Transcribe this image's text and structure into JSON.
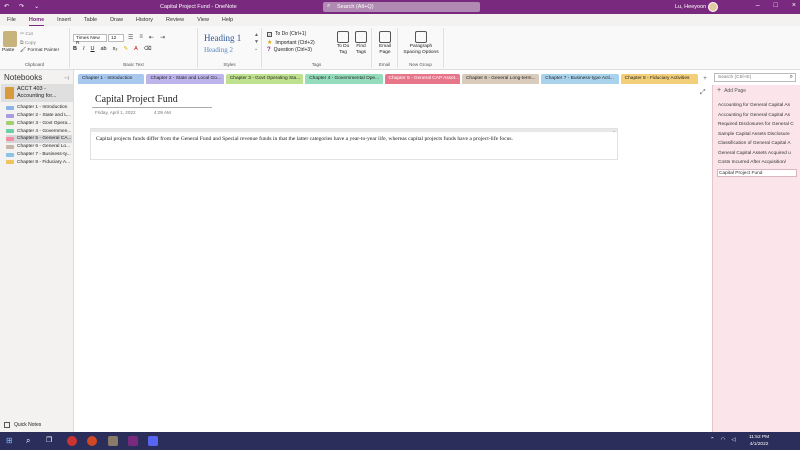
{
  "app": {
    "doc_title": "Capital Project Fund - OneNote",
    "search_placeholder": "Search (Alt+Q)",
    "user_name": "Lu, Heeyoon",
    "quick_access": [
      "↶",
      "↷",
      "⌄"
    ]
  },
  "ribbon_tabs": [
    "File",
    "Home",
    "Insert",
    "Table",
    "Draw",
    "History",
    "Review",
    "View",
    "Help"
  ],
  "clipboard": {
    "paste": "Paste",
    "cut": "Cut",
    "copy": "Copy",
    "format_painter": "Format Painter",
    "group": "Clipboard"
  },
  "basic_text": {
    "font": "Times New R",
    "size": "12",
    "bold": "B",
    "italic": "I",
    "underline": "U",
    "group": "Basic Text"
  },
  "styles": {
    "heading1": "Heading 1",
    "heading2": "Heading 2",
    "group": "Styles"
  },
  "tags": {
    "todo": "To Do (Ctrl+1)",
    "important": "Important (Ctrl+2)",
    "question": "Question (Ctrl+3)",
    "group": "Tags",
    "todo_tag": "To Do Tag",
    "find_tags": "Find Tags"
  },
  "email": {
    "label": "Email Page",
    "group": "Email"
  },
  "new_group": {
    "label": "Paragraph Spacing Options",
    "group": "New Group"
  },
  "notebook": {
    "header": "Notebooks",
    "title": "ACCT 403 - Accounting for...",
    "sections": [
      {
        "label": "Chapter 1 - Introduction",
        "color": "#8ab4e8"
      },
      {
        "label": "Chapter 2 - State and L...",
        "color": "#a79ce0"
      },
      {
        "label": "Chapter 3 - Govt Opera...",
        "color": "#a5cf6e"
      },
      {
        "label": "Chapter 4 - Governmen...",
        "color": "#6ccfa4"
      },
      {
        "label": "Chapter 5 - General CA...",
        "color": "#ef8f9f"
      },
      {
        "label": "Chapter 6 - General Lo...",
        "color": "#c7b6a3"
      },
      {
        "label": "Chapter 7 - Business-ty...",
        "color": "#88c4e6"
      },
      {
        "label": "Chapter 8 - Fiduciary A...",
        "color": "#efc45c"
      }
    ],
    "quick_notes": "Quick Notes"
  },
  "section_tabs": [
    {
      "label": "Chapter 1 - Introduction",
      "color": "#a9c8ef"
    },
    {
      "label": "Chapter 2 - State and Local Go...",
      "color": "#beb4ec"
    },
    {
      "label": "Chapter 3 - Govt Operating Sta...",
      "color": "#bfe08f"
    },
    {
      "label": "Chapter 4 - Governmental Ope...",
      "color": "#94dcbc"
    },
    {
      "label": "Chapter 5 - General CAP Asset...",
      "color": "#e8768a"
    },
    {
      "label": "Chapter 6 - General Long-term...",
      "color": "#d9ccbd"
    },
    {
      "label": "Chapter 7 - Business-type Acti...",
      "color": "#a9d3ec"
    },
    {
      "label": "Chapter 8 - Fiduciary Activities",
      "color": "#f2cf78"
    }
  ],
  "page_search_placeholder": "Search (Ctrl+E)",
  "page": {
    "title": "Capital Project Fund",
    "date": "Friday, April 1, 2022",
    "time": "4:09 AM",
    "body": "Capital projects funds differ from the General Fund and Special revenue funds in that the latter categories have a year-to-year life, whereas capital projects funds have a project-life focus."
  },
  "page_list": {
    "add_page": "Add Page",
    "pages": [
      "Accounting for General Capital As",
      "Accounting for General Capital As",
      "Required Disclosures for General C",
      "Sample Capital Assets Disclosure",
      "Classification of General Capital A",
      "General Capital Assets Acquired u",
      "Costs Incurred After Acquisition/",
      "Capital Project Fund"
    ]
  },
  "taskbar": {
    "time": "11:52 PM",
    "date": "4/1/2022"
  },
  "colors": {
    "accent": "#7a2a7e",
    "taskbar": "#2b2e5a",
    "page_pane": "#fbe5ea"
  }
}
